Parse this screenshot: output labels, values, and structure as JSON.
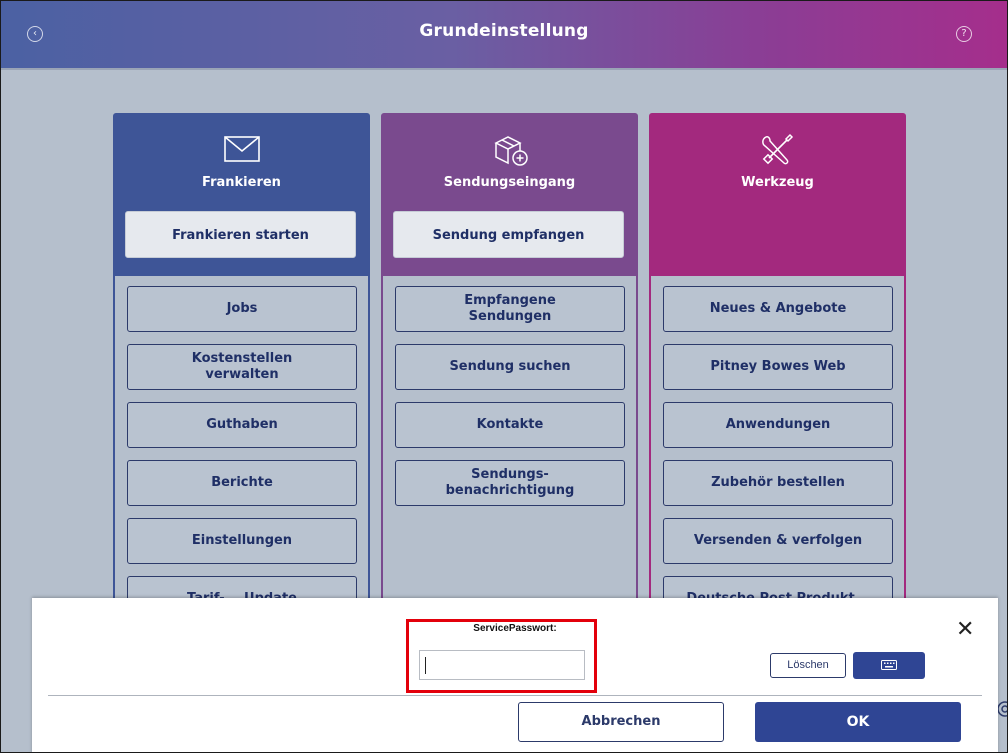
{
  "window": {
    "title": "Grundeinstellung",
    "back_icon": "back-circle-icon",
    "help_icon": "help-circle-icon"
  },
  "columns": [
    {
      "title": "Frankieren",
      "icon": "envelope-icon",
      "primary_button": "Frankieren starten",
      "color": "#3e5597",
      "items": [
        "Jobs",
        "Kostenstellen\nverwalten",
        "Guthaben",
        "Berichte",
        "Einstellungen",
        "Tarif-... Update"
      ]
    },
    {
      "title": "Sendungseingang",
      "icon": "package-add-icon",
      "primary_button": "Sendung empfangen",
      "color": "#7a4a8e",
      "items": [
        "Empfangene\nSendungen",
        "Sendung suchen",
        "Kontakte",
        "Sendungs-\nbenachrichtigung"
      ]
    },
    {
      "title": "Werkzeug",
      "icon": "tools-icon",
      "primary_button": "",
      "color": "#a3297e",
      "items": [
        "Neues & Angebote",
        "Pitney Bowes Web",
        "Anwendungen",
        "Zubehör bestellen",
        "Versenden & verfolgen",
        "Deutsche Post Produkt..."
      ]
    }
  ],
  "dialog": {
    "label": "ServicePasswort:",
    "input_value": "",
    "clear_button": "Löschen",
    "keyboard_icon": "keyboard-icon",
    "cancel_button": "Abbrechen",
    "ok_button": "OK",
    "close_icon": "close-icon"
  },
  "colors": {
    "highlight": "#e3000b",
    "primary": "#2f4594"
  }
}
